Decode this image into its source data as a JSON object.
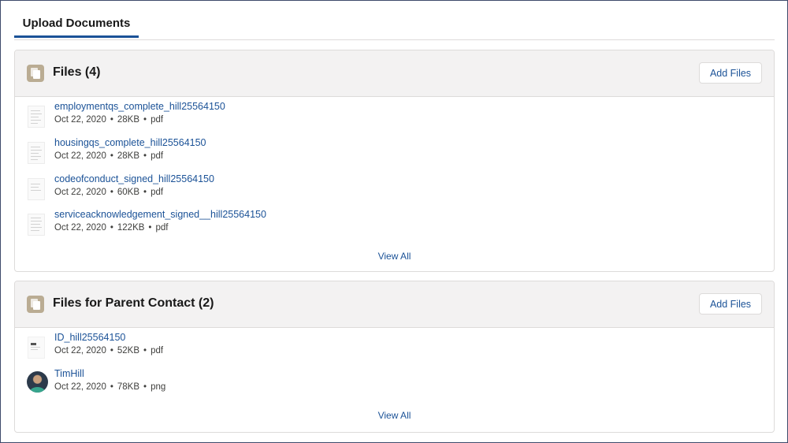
{
  "tabs": [
    {
      "label": "Upload Documents",
      "active": true
    }
  ],
  "files_card": {
    "title": "Files (4)",
    "add_button": "Add Files",
    "view_all": "View All",
    "items": [
      {
        "name": "employmentqs_complete_hill25564150",
        "date": "Oct 22, 2020",
        "size": "28KB",
        "type": "pdf",
        "thumb": "document-thumbnail"
      },
      {
        "name": "housingqs_complete_hill25564150",
        "date": "Oct 22, 2020",
        "size": "28KB",
        "type": "pdf",
        "thumb": "document-thumbnail"
      },
      {
        "name": "codeofconduct_signed_hill25564150",
        "date": "Oct 22, 2020",
        "size": "60KB",
        "type": "pdf",
        "thumb": "document-thumbnail"
      },
      {
        "name": "serviceacknowledgement_signed__hill25564150",
        "date": "Oct 22, 2020",
        "size": "122KB",
        "type": "pdf",
        "thumb": "document-thumbnail"
      }
    ]
  },
  "parent_card": {
    "title": "Files for Parent Contact (2)",
    "add_button": "Add Files",
    "view_all": "View All",
    "items": [
      {
        "name": "ID_hill25564150",
        "date": "Oct 22, 2020",
        "size": "52KB",
        "type": "pdf",
        "thumb": "document-thumbnail"
      },
      {
        "name": "TimHill",
        "date": "Oct 22, 2020",
        "size": "78KB",
        "type": "png",
        "thumb": "avatar-thumbnail"
      }
    ]
  },
  "separator": "•",
  "colors": {
    "link": "#1b5297",
    "header_bg": "#f3f2f2",
    "icon_bg": "#baac93",
    "border": "#dddbda"
  }
}
